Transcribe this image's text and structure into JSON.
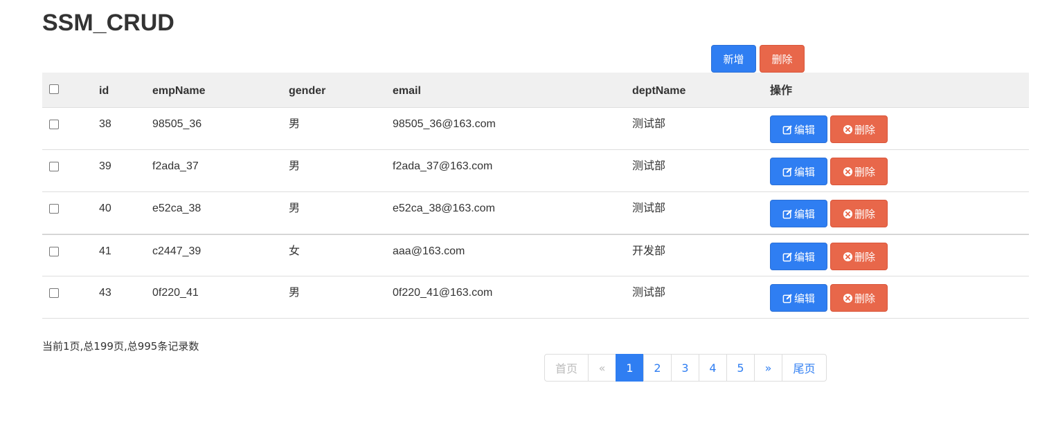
{
  "title": "SSM_CRUD",
  "toolbar": {
    "add_label": "新增",
    "delete_label": "删除"
  },
  "table": {
    "headers": {
      "id": "id",
      "empName": "empName",
      "gender": "gender",
      "email": "email",
      "deptName": "deptName",
      "ops": "操作"
    },
    "rows": [
      {
        "id": "38",
        "empName": "98505_36",
        "gender": "男",
        "email": "98505_36@163.com",
        "deptName": "测试部"
      },
      {
        "id": "39",
        "empName": "f2ada_37",
        "gender": "男",
        "email": "f2ada_37@163.com",
        "deptName": "测试部"
      },
      {
        "id": "40",
        "empName": "e52ca_38",
        "gender": "男",
        "email": "e52ca_38@163.com",
        "deptName": "测试部"
      },
      {
        "id": "41",
        "empName": "c2447_39",
        "gender": "女",
        "email": "aaa@163.com",
        "deptName": "开发部"
      },
      {
        "id": "43",
        "empName": "0f220_41",
        "gender": "男",
        "email": "0f220_41@163.com",
        "deptName": "测试部"
      }
    ],
    "edit_label": "编辑",
    "delete_label": "删除"
  },
  "pager": {
    "info": "当前1页,总199页,总995条记录数",
    "first": "首页",
    "prev": "«",
    "pages": [
      "1",
      "2",
      "3",
      "4",
      "5"
    ],
    "next": "»",
    "last": "尾页",
    "current": "1"
  },
  "colors": {
    "primary": "#2f7ef2",
    "danger": "#e8674a",
    "header_bg": "#f0f0f0"
  },
  "icons": {
    "edit": "pencil-square-icon",
    "delete": "times-circle-icon"
  }
}
